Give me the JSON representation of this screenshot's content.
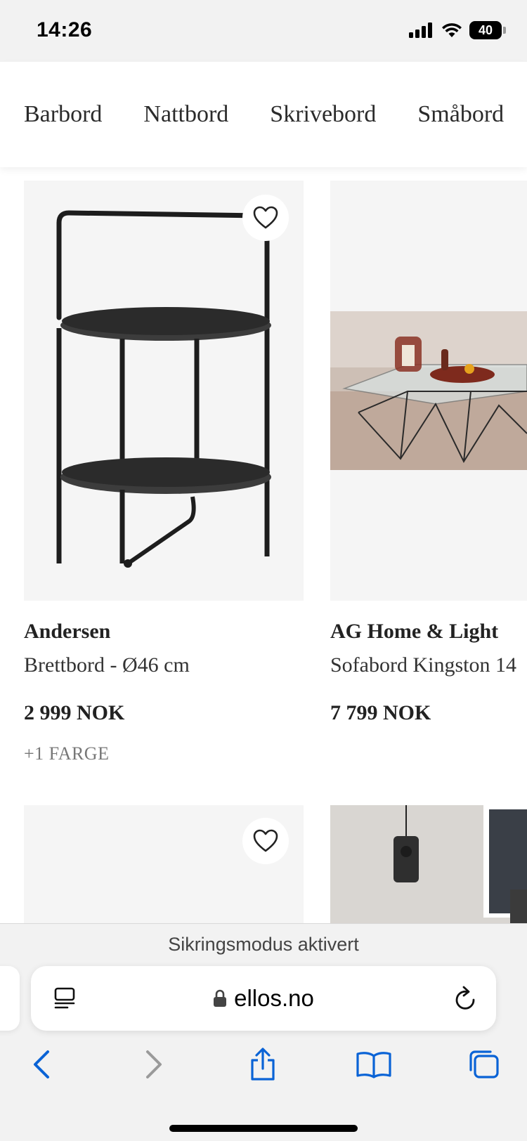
{
  "status_bar": {
    "time": "14:26",
    "battery_level": "40"
  },
  "categories": [
    "Barbord",
    "Nattbord",
    "Skrivebord",
    "Småbord"
  ],
  "products": [
    {
      "brand": "Andersen",
      "name": "Brettbord - Ø46 cm",
      "price": "2 999 NOK",
      "colors": "+1 FARGE",
      "favorite": false
    },
    {
      "brand": "AG Home & Light",
      "name": "Sofabord Kingston 14",
      "price": "7 799 NOK",
      "colors": "",
      "favorite": false
    }
  ],
  "browser": {
    "lockdown_notice": "Sikringsmodus aktivert",
    "url": "ellos.no",
    "accent_color": "#0a63d6"
  }
}
